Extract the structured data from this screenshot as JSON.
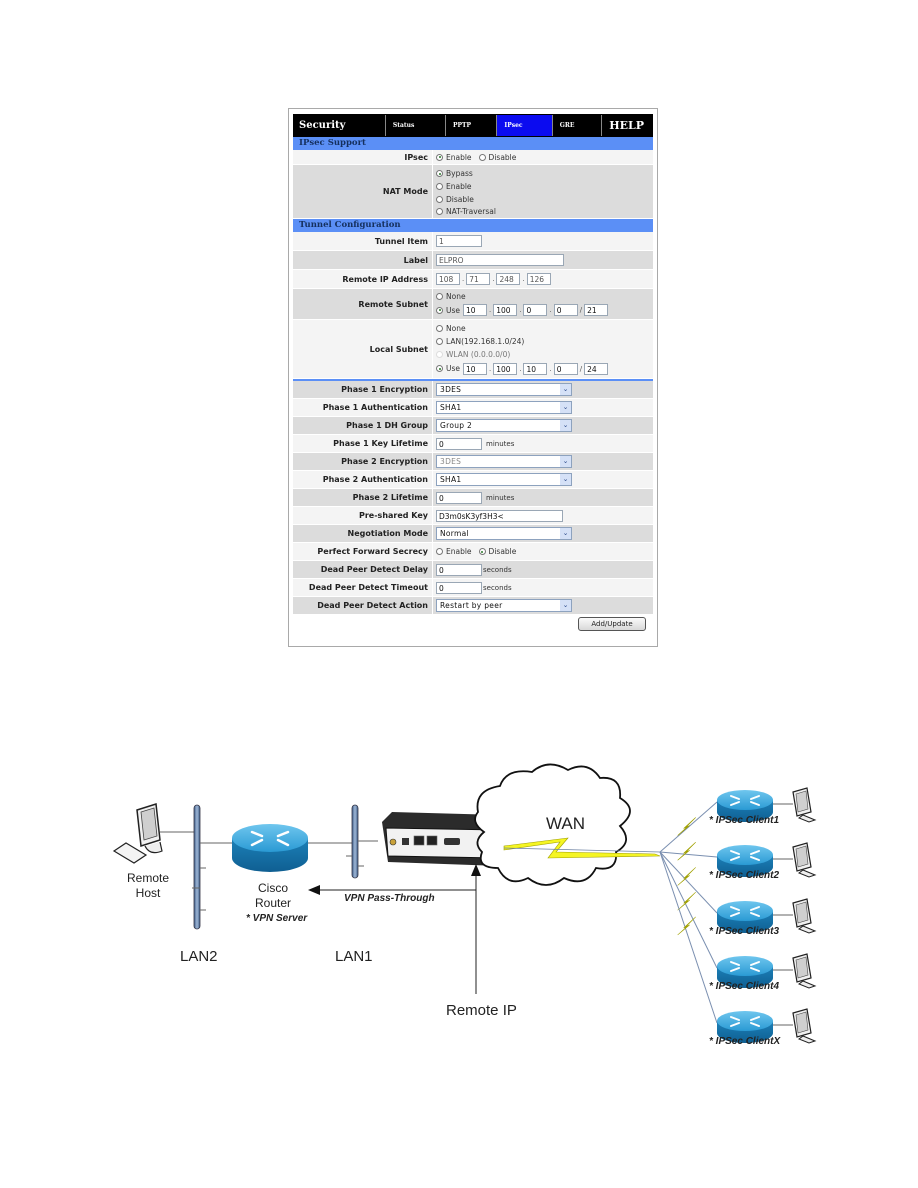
{
  "panel": {
    "tabs": [
      {
        "label": "Security",
        "kind": "title"
      },
      {
        "label": "Status",
        "kind": "tab"
      },
      {
        "label": "PPTP",
        "kind": "tab"
      },
      {
        "label": "IPsec",
        "kind": "tab",
        "active": true
      },
      {
        "label": "GRE",
        "kind": "tab"
      },
      {
        "label": "HELP",
        "kind": "help"
      }
    ],
    "ipsec_support": {
      "section_title": "IPsec Support",
      "ipsec": {
        "label": "IPsec",
        "options": [
          "Enable",
          "Disable"
        ],
        "selected": "Enable"
      },
      "nat_mode": {
        "label": "NAT Mode",
        "options": [
          "Bypass",
          "Enable",
          "Disable",
          "NAT-Traversal"
        ],
        "selected": "Bypass"
      }
    },
    "tunnel": {
      "section_title": "Tunnel Configuration",
      "tunnel_item": {
        "label": "Tunnel Item",
        "value": "1"
      },
      "label": {
        "label": "Label",
        "value": "ELPRO"
      },
      "remote_ip": {
        "label": "Remote IP Address",
        "octets": [
          "108",
          "71",
          "248",
          "126"
        ]
      },
      "remote_subnet": {
        "label": "Remote Subnet",
        "options": [
          "None",
          "Use"
        ],
        "selected": "Use",
        "octets": [
          "10",
          "100",
          "0",
          "0"
        ],
        "mask": "21"
      },
      "local_subnet": {
        "label": "Local Subnet",
        "options": [
          "None",
          "LAN(192.168.1.0/24)",
          "WLAN (0.0.0.0/0)",
          "Use"
        ],
        "selected": "Use",
        "octets": [
          "10",
          "100",
          "10",
          "0"
        ],
        "mask": "24"
      }
    },
    "phase": {
      "p1_enc": {
        "label": "Phase 1 Encryption",
        "value": "3DES"
      },
      "p1_auth": {
        "label": "Phase 1 Authentication",
        "value": "SHA1"
      },
      "p1_dh": {
        "label": "Phase 1 DH Group",
        "value": "Group 2"
      },
      "p1_life": {
        "label": "Phase 1 Key Lifetime",
        "value": "0",
        "unit": "minutes"
      },
      "p2_enc": {
        "label": "Phase 2 Encryption",
        "value": "3DES"
      },
      "p2_auth": {
        "label": "Phase 2 Authentication",
        "value": "SHA1"
      },
      "p2_life": {
        "label": "Phase 2 Lifetime",
        "value": "0",
        "unit": "minutes"
      },
      "psk": {
        "label": "Pre-shared Key",
        "value": "D3m0sK3yf3H3<"
      },
      "neg_mode": {
        "label": "Negotiation Mode",
        "value": "Normal"
      },
      "pfs": {
        "label": "Perfect Forward Secrecy",
        "options": [
          "Enable",
          "Disable"
        ],
        "selected": "Disable"
      },
      "dpd_delay": {
        "label": "Dead Peer Detect Delay",
        "value": "0",
        "unit": "seconds"
      },
      "dpd_timeout": {
        "label": "Dead Peer Detect Timeout",
        "value": "0",
        "unit": "seconds"
      },
      "dpd_action": {
        "label": "Dead Peer Detect Action",
        "value": "Restart by peer"
      }
    },
    "add_update_label": "Add/Update"
  },
  "diagram": {
    "remote_host": "Remote\nHost",
    "router_name": "Cisco\nRouter",
    "router_role": "* VPN Server",
    "vpn_pass": "VPN Pass-Through",
    "lan2": "LAN2",
    "lan1": "LAN1",
    "remote_ip": "Remote IP",
    "wan": "WAN",
    "clients": [
      "* IPSec Client1",
      "* IPSec Client2",
      "* IPSec Client3",
      "* IPSec Client4",
      "* IPSec ClientX"
    ],
    "colors": {
      "router": "#1f86c0",
      "lightning": "#f5f523",
      "lan_bar": "#6f8fb8"
    }
  }
}
